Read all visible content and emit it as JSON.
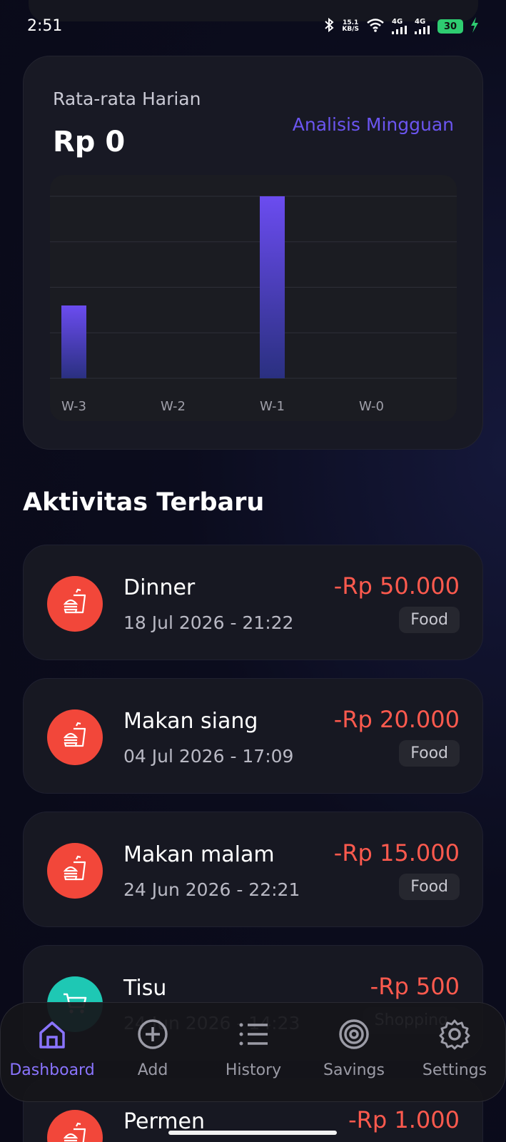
{
  "status_bar": {
    "time": "2:51",
    "speed_value": "15.1",
    "speed_unit": "KB/S",
    "network1": "4G",
    "network2": "4G",
    "battery": "30"
  },
  "summary": {
    "label": "Rata-rata Harian",
    "value": "Rp 0",
    "link": "Analisis Mingguan"
  },
  "chart_data": {
    "type": "bar",
    "categories": [
      "W-3",
      "W-2",
      "W-1",
      "W-0"
    ],
    "values": [
      40,
      0,
      100,
      0
    ],
    "title": "",
    "xlabel": "",
    "ylabel": "",
    "ylim": [
      0,
      100
    ],
    "grid": true,
    "bar_color_top": "#6b4cf0",
    "bar_color_bottom": "#2a3080"
  },
  "section": {
    "title": "Aktivitas Terbaru"
  },
  "activities": [
    {
      "title": "Dinner",
      "date": "18  Jul 2026 - 21:22",
      "amount": "-Rp 50.000",
      "category": "Food",
      "icon": "burger-icon",
      "color": "#f2473a"
    },
    {
      "title": "Makan siang",
      "date": "04  Jul 2026 - 17:09",
      "amount": "-Rp 20.000",
      "category": "Food",
      "icon": "burger-icon",
      "color": "#f2473a"
    },
    {
      "title": "Makan malam",
      "date": "24  Jun 2026 - 22:21",
      "amount": "-Rp 15.000",
      "category": "Food",
      "icon": "burger-icon",
      "color": "#f2473a"
    },
    {
      "title": "Tisu",
      "date": "24  Jun 2026 - 14:23",
      "amount": "-Rp 500",
      "category": "Shopping",
      "icon": "cart-icon",
      "color": "#1ec8b4"
    },
    {
      "title": "Permen",
      "date": "",
      "amount": "-Rp 1.000",
      "category": "",
      "icon": "burger-icon",
      "color": "#f2473a"
    }
  ],
  "nav": {
    "dashboard": "Dashboard",
    "add": "Add",
    "history": "History",
    "savings": "Savings",
    "settings": "Settings"
  }
}
